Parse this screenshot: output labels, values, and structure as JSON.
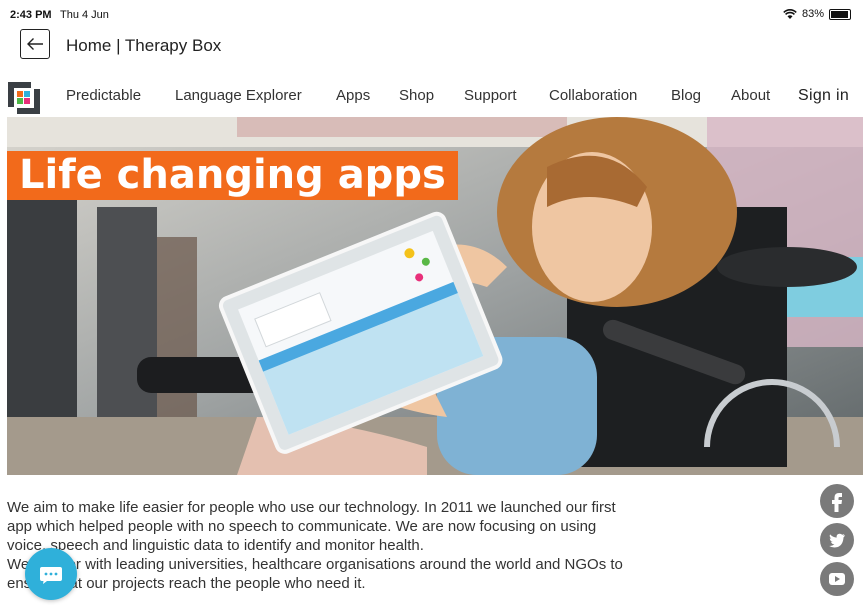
{
  "status": {
    "time": "2:43 PM",
    "date": "Thu 4 Jun",
    "battery": "83%",
    "battery_level": 0.83
  },
  "header": {
    "title": "Home | Therapy Box"
  },
  "nav": {
    "items": [
      "Predictable",
      "Language Explorer",
      "Apps",
      "Shop",
      "Support",
      "Collaboration",
      "Blog",
      "About"
    ],
    "signin": "Sign in"
  },
  "hero": {
    "headline": "Life changing apps",
    "accent_color": "#f26a1b"
  },
  "body": {
    "lines": [
      "We aim to make life easier for people who use our technology. In 2011 we launched our first",
      "app which helped people with no speech to communicate. We are now focusing on using",
      "voice, speech and linguistic data to identify and monitor health.",
      "We partner with leading universities, healthcare organisations around the world and NGOs to",
      "ensure that our projects reach the people who need it."
    ]
  },
  "social": [
    "facebook-icon",
    "twitter-icon",
    "youtube-icon"
  ],
  "chat_color": "#2fb0da"
}
